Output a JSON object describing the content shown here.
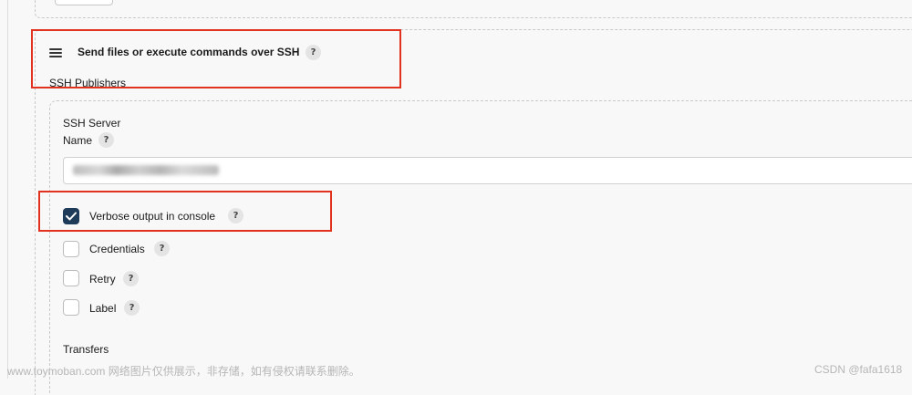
{
  "publisher_section": {
    "title": "Send files or execute commands over SSH",
    "help": "?",
    "ssh_publishers_label": "SSH Publishers"
  },
  "ssh_server": {
    "heading": "SSH Server",
    "name_label": "Name",
    "name_help": "?",
    "name_value": ""
  },
  "options": [
    {
      "label": "Verbose output in console",
      "checked": true,
      "help": "?"
    },
    {
      "label": "Credentials",
      "checked": false,
      "help": "?"
    },
    {
      "label": "Retry",
      "checked": false,
      "help": "?"
    },
    {
      "label": "Label",
      "checked": false,
      "help": "?"
    }
  ],
  "transfers_label": "Transfers",
  "watermark": {
    "left": "www.toymoban.com 网络图片仅供展示，非存储，如有侵权请联系删除。",
    "right": "CSDN @fafa1618"
  },
  "colors": {
    "highlight": "#e0321f",
    "checkbox_checked": "#1f3b5a"
  }
}
